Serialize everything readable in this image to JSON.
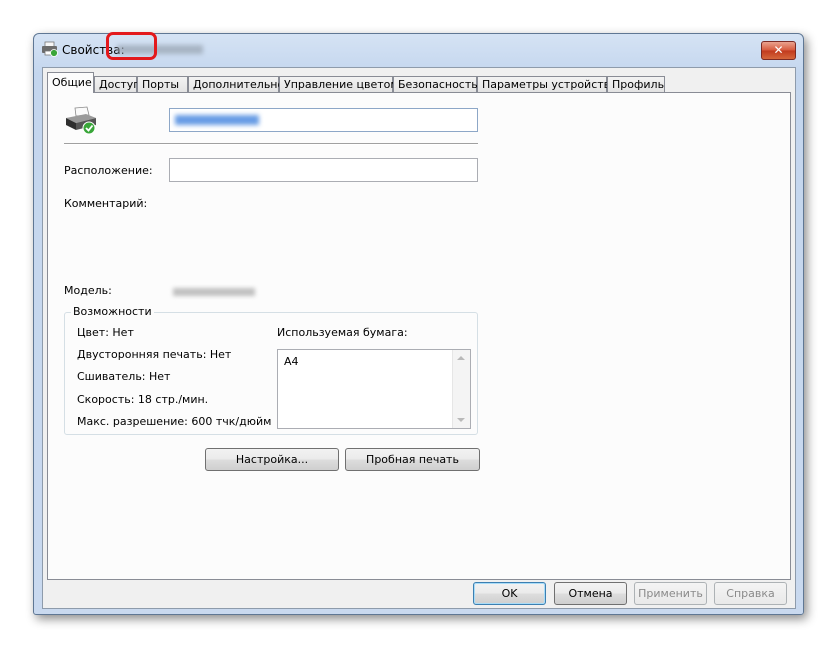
{
  "window": {
    "title": "Свойства:"
  },
  "tabs": [
    {
      "label": "Общие",
      "active": true
    },
    {
      "label": "Доступ"
    },
    {
      "label": "Порты",
      "highlighted": true
    },
    {
      "label": "Дополнительно"
    },
    {
      "label": "Управление цветом"
    },
    {
      "label": "Безопасность"
    },
    {
      "label": "Параметры устройства"
    },
    {
      "label": "Профиль"
    }
  ],
  "general": {
    "location_label": "Расположение:",
    "location_value": "",
    "comment_label": "Комментарий:",
    "model_label": "Модель:"
  },
  "features": {
    "legend": "Возможности",
    "color": "Цвет: Нет",
    "duplex": "Двусторонняя печать: Нет",
    "staple": "Сшиватель: Нет",
    "speed": "Скорость: 18 стр./мин.",
    "resolution": "Макс. разрешение: 600 тчк/дюйм",
    "paper_label": "Используемая бумага:",
    "paper_items": [
      "A4"
    ]
  },
  "buttons": {
    "setup": "Настройка...",
    "test_page": "Пробная печать",
    "ok": "OK",
    "cancel": "Отмена",
    "apply": "Применить",
    "help": "Справка"
  },
  "colors": {
    "highlight": "#e3191c",
    "title_bar": "#c9d9ef",
    "close_button": "#c94a2e"
  },
  "icons": {
    "title": "printer-icon",
    "header": "printer-default-icon",
    "close": "close-icon"
  }
}
